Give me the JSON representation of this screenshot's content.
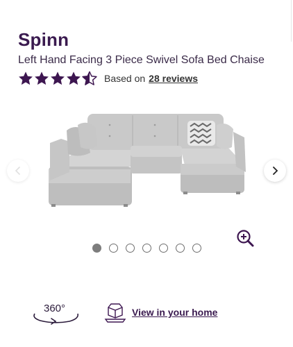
{
  "product": {
    "brand": "Spinn",
    "title": "Left Hand Facing 3 Piece Swivel Sofa Bed Chaise"
  },
  "rating": {
    "value": 4.5,
    "max": 5,
    "prefix": "Based on",
    "reviews_link": "28 reviews",
    "star_color": "#3d1650"
  },
  "gallery": {
    "image_count": 7,
    "active_index": 0,
    "image_alt": "grey L-shaped sofa with chaise and cushions"
  },
  "actions": {
    "view360_label": "360°",
    "ar_label": "View in your home"
  },
  "icons": {
    "prev": "chevron-left-icon",
    "next": "chevron-right-icon",
    "zoom": "zoom-in-icon",
    "rotate": "rotate-360-icon",
    "ar": "ar-cube-icon"
  }
}
